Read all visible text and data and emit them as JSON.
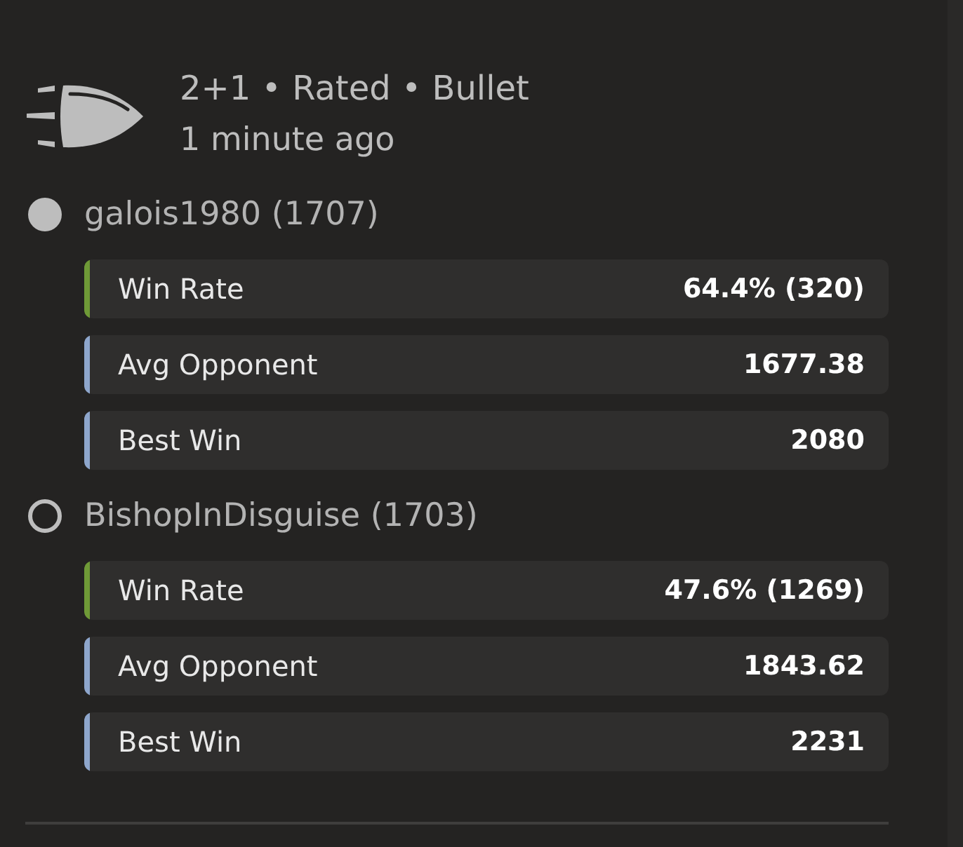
{
  "game": {
    "title": "2+1 • Rated • Bullet",
    "time": "1 minute ago"
  },
  "players": [
    {
      "name": "galois1980 (1707)",
      "filled": true,
      "stats": [
        {
          "label": "Win Rate",
          "value": "64.4% (320)",
          "color": "#6f9a37"
        },
        {
          "label": "Avg Opponent",
          "value": "1677.38",
          "color": "#8ea6cc"
        },
        {
          "label": "Best Win",
          "value": "2080",
          "color": "#8ea6cc"
        }
      ]
    },
    {
      "name": "BishopInDisguise (1703)",
      "filled": false,
      "stats": [
        {
          "label": "Win Rate",
          "value": "47.6% (1269)",
          "color": "#6f9a37"
        },
        {
          "label": "Avg Opponent",
          "value": "1843.62",
          "color": "#8ea6cc"
        },
        {
          "label": "Best Win",
          "value": "2231",
          "color": "#8ea6cc"
        }
      ]
    }
  ]
}
